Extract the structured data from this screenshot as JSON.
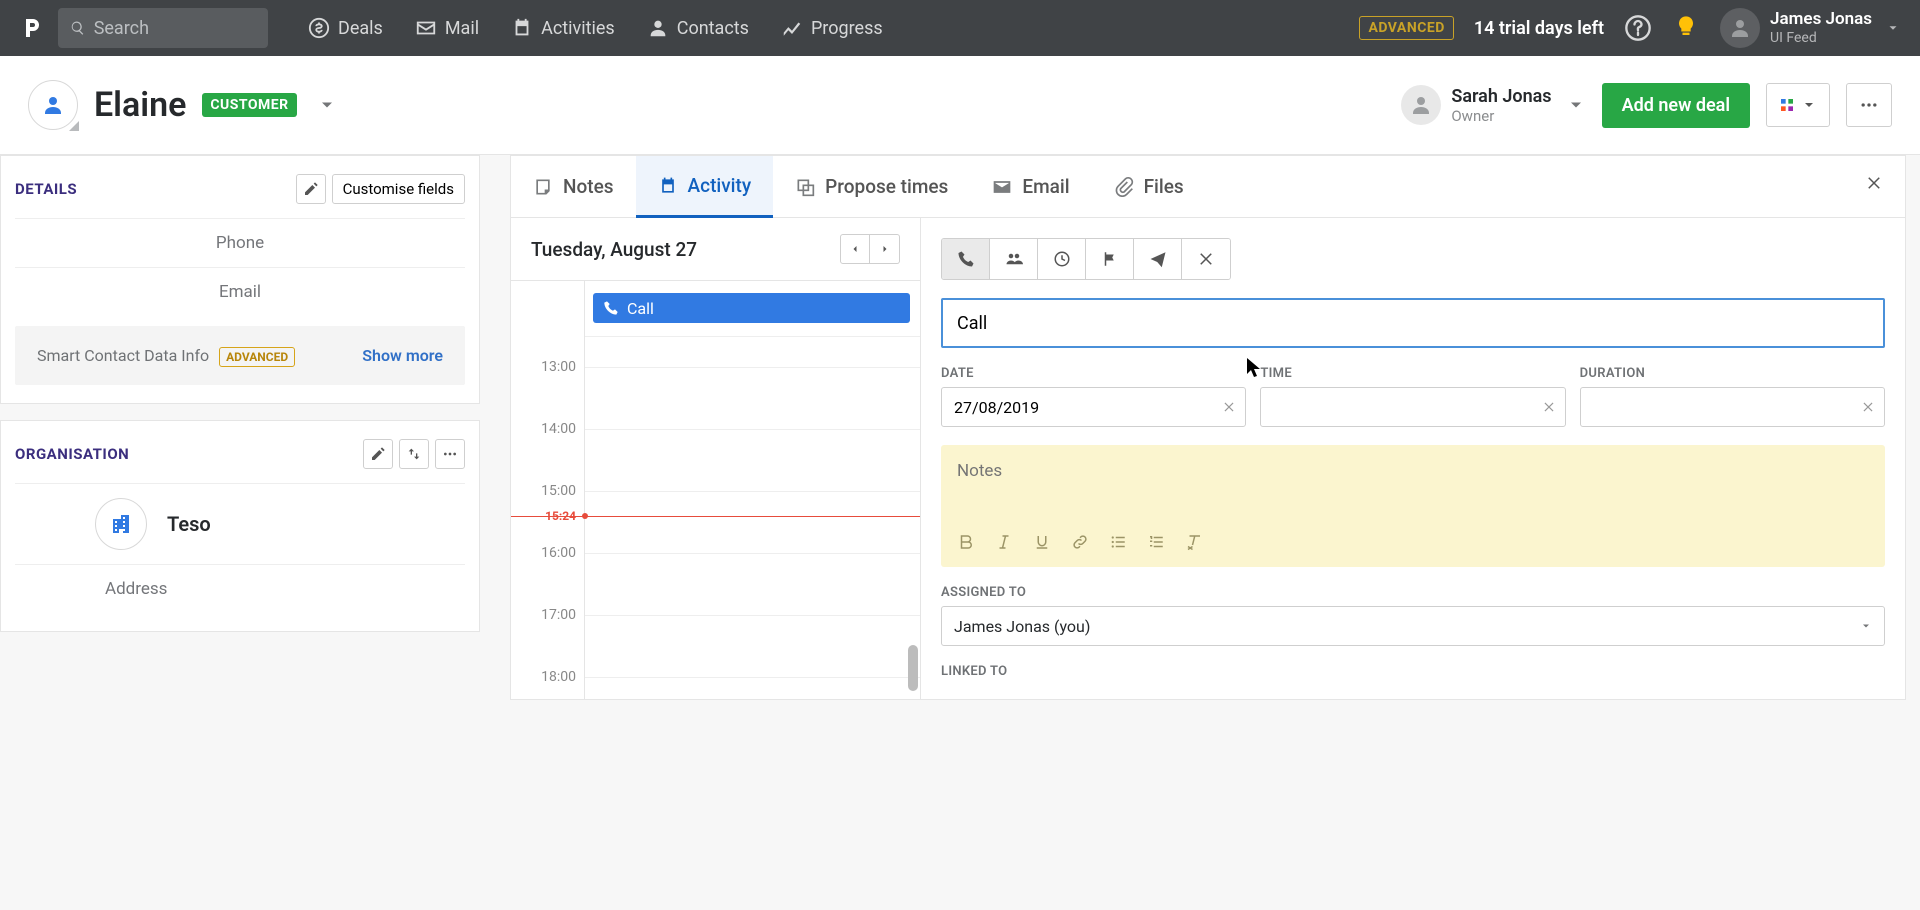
{
  "nav": {
    "search_placeholder": "Search",
    "items": [
      {
        "label": "Deals"
      },
      {
        "label": "Mail"
      },
      {
        "label": "Activities"
      },
      {
        "label": "Contacts"
      },
      {
        "label": "Progress"
      }
    ],
    "advanced_badge": "ADVANCED",
    "trial_text": "14 trial days left",
    "user": {
      "name": "James Jonas",
      "sub": "UI Feed"
    }
  },
  "header": {
    "contact_name": "Elaine",
    "status_badge": "CUSTOMER",
    "owner": {
      "name": "Sarah Jonas",
      "role": "Owner"
    },
    "add_deal": "Add new deal"
  },
  "details": {
    "title": "DETAILS",
    "customise": "Customise fields",
    "fields": [
      {
        "label": "Phone"
      },
      {
        "label": "Email"
      }
    ],
    "smart_label": "Smart Contact Data Info",
    "smart_badge": "ADVANCED",
    "show_more": "Show more"
  },
  "organisation": {
    "title": "ORGANISATION",
    "name": "Teso",
    "address_label": "Address"
  },
  "tabs": {
    "items": [
      {
        "label": "Notes"
      },
      {
        "label": "Activity"
      },
      {
        "label": "Propose times"
      },
      {
        "label": "Email"
      },
      {
        "label": "Files"
      }
    ]
  },
  "calendar": {
    "date_label": "Tuesday, August 27",
    "hours": [
      "13:00",
      "14:00",
      "15:00",
      "16:00",
      "17:00",
      "18:00"
    ],
    "now_label": "15:24",
    "event_label": "Call"
  },
  "form": {
    "subject_value": "Call",
    "date_label": "DATE",
    "time_label": "TIME",
    "duration_label": "DURATION",
    "date_value": "27/08/2019",
    "time_value": "",
    "duration_value": "",
    "notes_placeholder": "Notes",
    "assigned_label": "ASSIGNED TO",
    "assigned_value": "James Jonas (you)",
    "linked_label": "LINKED TO"
  }
}
